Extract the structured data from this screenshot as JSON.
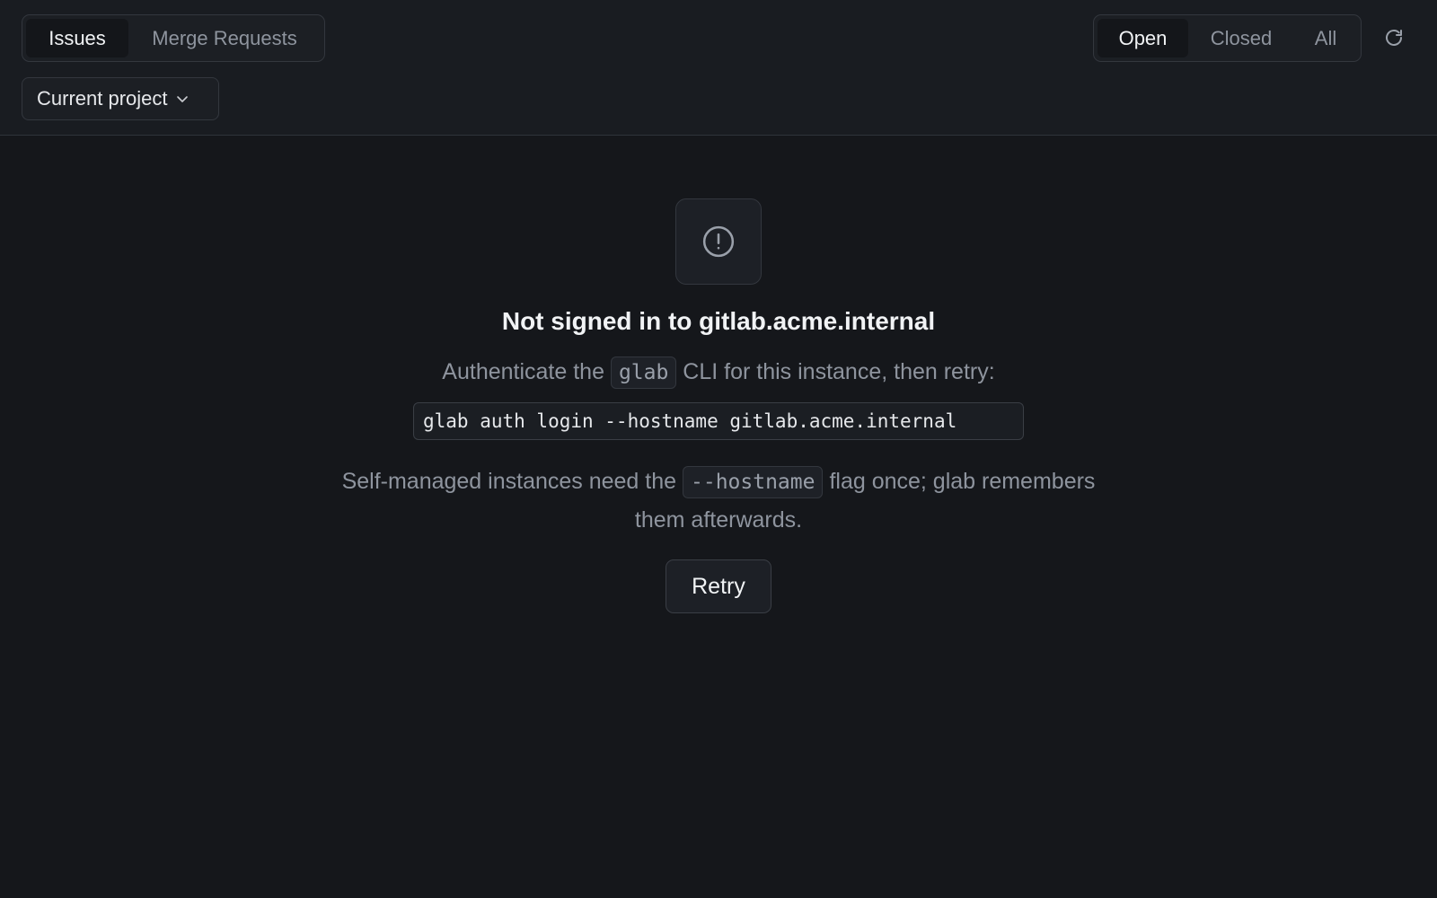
{
  "tabs": {
    "issues": "Issues",
    "merge_requests": "Merge Requests",
    "active": "Issues"
  },
  "state_filter": {
    "open": "Open",
    "closed": "Closed",
    "all": "All",
    "active": "Open"
  },
  "scope_select": {
    "value": "Current project"
  },
  "empty_state": {
    "title": "Not signed in to gitlab.acme.internal",
    "desc_before": "Authenticate the",
    "desc_code": "glab",
    "desc_after": "CLI for this instance, then retry:",
    "command": "glab auth login --hostname gitlab.acme.internal",
    "hint_before": "Self-managed instances need the",
    "hint_code": "--hostname",
    "hint_after": "flag once; glab remembers them afterwards.",
    "retry_label": "Retry"
  },
  "icons": {
    "refresh": "refresh-icon",
    "chevron": "chevron-down-icon",
    "alert": "alert-circle-icon"
  },
  "colors": {
    "background": "#15171b",
    "toolbar": "#191c21",
    "muted_text": "#8e949e",
    "primary_text": "#f1f3f5",
    "border": "#33373e"
  }
}
